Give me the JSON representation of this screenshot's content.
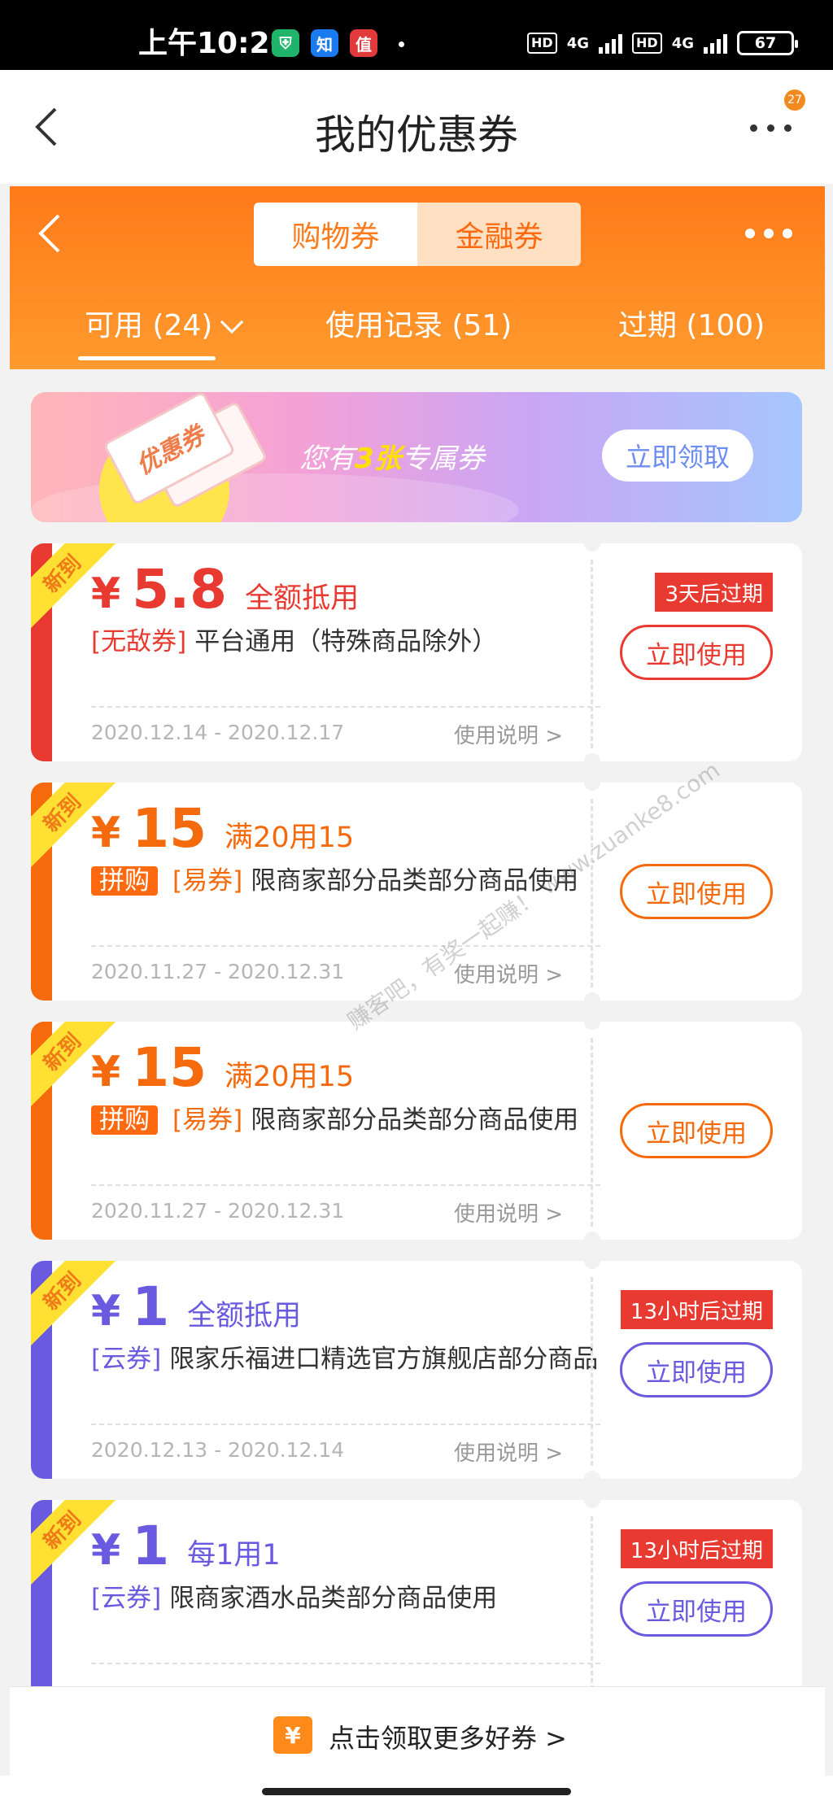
{
  "status": {
    "time": "上午10:26",
    "apps": [
      "知"
    ],
    "hd_label": "HD",
    "net": "4G",
    "battery": "67"
  },
  "nav": {
    "title": "我的优惠券",
    "badge": "27"
  },
  "header": {
    "seg_shopping": "购物券",
    "seg_finance": "金融券",
    "tab_available": "可用 (24)",
    "tab_history": "使用记录 (51)",
    "tab_expired": "过期 (100)"
  },
  "banner": {
    "ticket_label": "优惠券",
    "text_prefix": "您有",
    "count": "3张",
    "text_suffix": "专属券",
    "button": "立即领取"
  },
  "coupons": [
    {
      "badge": "新到",
      "yen": "¥",
      "amount": "5.8",
      "condition": "全额抵用",
      "tag1": "[无敌券]",
      "tag2": "",
      "desc": "平台通用（特殊商品除外）",
      "date": "2020.12.14 - 2020.12.17",
      "howto": "使用说明  >",
      "expire": "3天后过期",
      "button": "立即使用",
      "color": "#e83a30"
    },
    {
      "badge": "新到",
      "yen": "¥",
      "amount": "15",
      "condition": "满20用15",
      "tag1": "拼购",
      "tag2": "[易券]",
      "desc": "限商家部分品类部分商品使用",
      "date": "2020.11.27 - 2020.12.31",
      "howto": "使用说明  >",
      "expire": "",
      "button": "立即使用",
      "color": "#f46a0c"
    },
    {
      "badge": "新到",
      "yen": "¥",
      "amount": "15",
      "condition": "满20用15",
      "tag1": "拼购",
      "tag2": "[易券]",
      "desc": "限商家部分品类部分商品使用",
      "date": "2020.11.27 - 2020.12.31",
      "howto": "使用说明  >",
      "expire": "",
      "button": "立即使用",
      "color": "#f46a0c"
    },
    {
      "badge": "新到",
      "yen": "¥",
      "amount": "1",
      "condition": "全额抵用",
      "tag1": "[云券]",
      "tag2": "",
      "desc": "限家乐福进口精选官方旗舰店部分商品",
      "date": "2020.12.13 - 2020.12.14",
      "howto": "使用说明  >",
      "expire": "13小时后过期",
      "button": "立即使用",
      "color": "#6a5ae0"
    },
    {
      "badge": "新到",
      "yen": "¥",
      "amount": "1",
      "condition": "每1用1",
      "tag1": "[云券]",
      "tag2": "",
      "desc": "限商家酒水品类部分商品使用",
      "date": "",
      "howto": "",
      "expire": "13小时后过期",
      "button": "立即使用",
      "color": "#6a5ae0"
    }
  ],
  "bottom": {
    "icon_glyph": "¥",
    "text": "点击领取更多好券 >"
  },
  "watermark": "赚客吧，有奖一起赚！ www.zuanke8.com"
}
